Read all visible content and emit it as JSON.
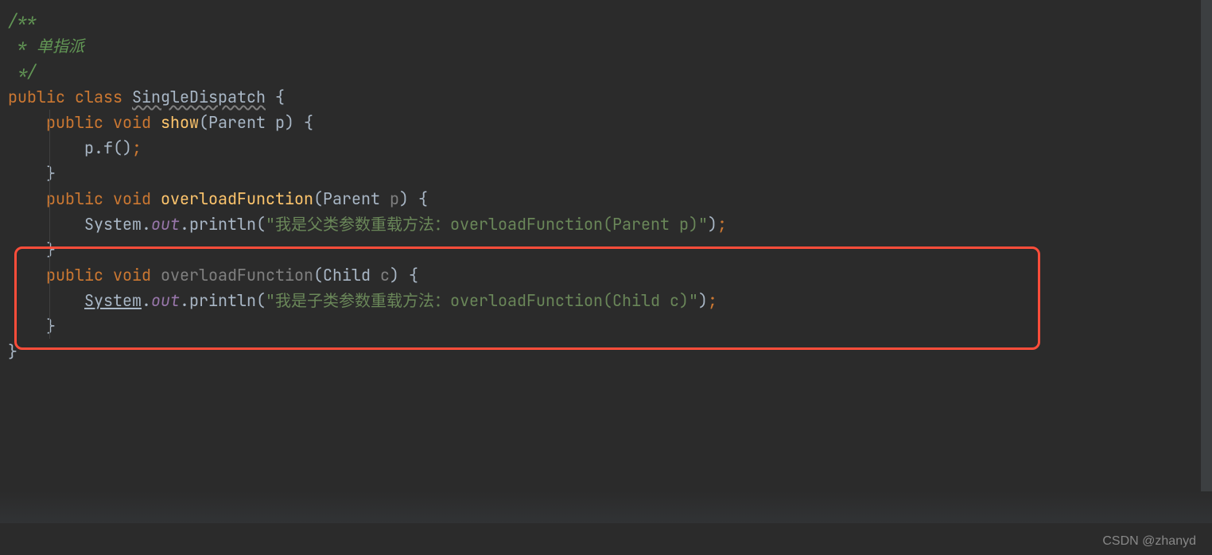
{
  "code": {
    "l1": "/**",
    "l2_prefix": " * ",
    "l2_text": "单指派",
    "l3": " */",
    "l4_public": "public ",
    "l4_class": "class ",
    "l4_name": "SingleDispatch",
    "l4_brace": " {",
    "l5_public": "    public ",
    "l5_void": "void ",
    "l5_method": "show",
    "l5_paren_o": "(",
    "l5_type": "Parent ",
    "l5_param": "p",
    "l5_paren_c": ") ",
    "l5_brace": "{",
    "l6_indent": "        ",
    "l6_p": "p",
    "l6_dot": ".",
    "l6_f": "f()",
    "l6_semi": ";",
    "l7_close": "    }",
    "l8_public": "    public ",
    "l8_void": "void ",
    "l8_method": "overloadFunction",
    "l8_paren_o": "(",
    "l8_type": "Parent ",
    "l8_param": "p",
    "l8_paren_c": ") ",
    "l8_brace": "{",
    "l9_indent": "        ",
    "l9_sys": "System",
    "l9_dot1": ".",
    "l9_out": "out",
    "l9_dot2": ".",
    "l9_println": "println(",
    "l9_string": "\"我是父类参数重载方法：overloadFunction(Parent p)\"",
    "l9_close": ")",
    "l9_semi": ";",
    "l10_close": "    }",
    "l11_public": "    public ",
    "l11_void": "void ",
    "l11_method": "overloadFunction",
    "l11_paren_o": "(",
    "l11_type": "Child ",
    "l11_param": "c",
    "l11_paren_c": ") ",
    "l11_brace": "{",
    "l12_indent": "        ",
    "l12_sys": "System",
    "l12_dot1": ".",
    "l12_out": "out",
    "l12_dot2": ".",
    "l12_println": "println(",
    "l12_string": "\"我是子类参数重载方法：overloadFunction(Child c)\"",
    "l12_close": ")",
    "l12_semi": ";",
    "l13_close": "    }",
    "l14_close": "}"
  },
  "watermark": "CSDN @zhanyd"
}
